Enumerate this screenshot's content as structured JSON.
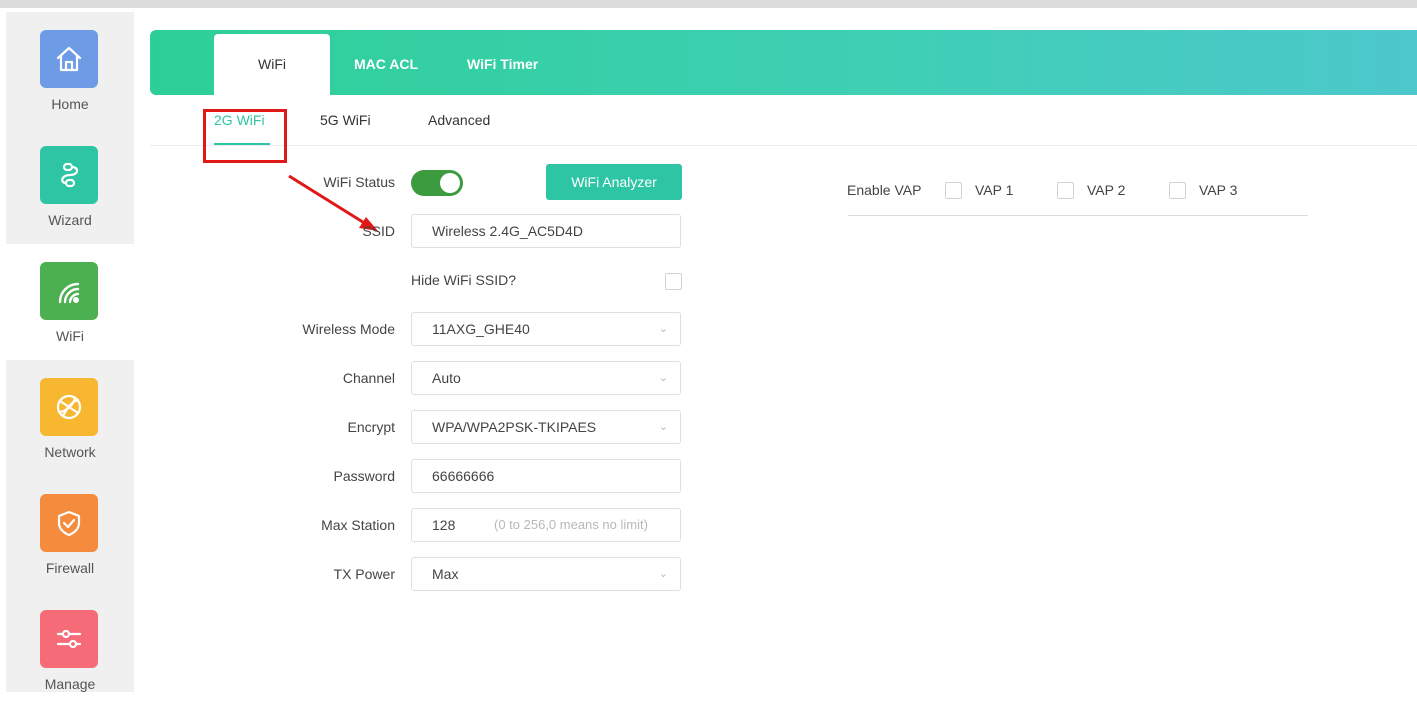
{
  "sidebar": {
    "items": [
      {
        "label": "Home",
        "icon": "home-icon",
        "color": "#6e9be6"
      },
      {
        "label": "Wizard",
        "icon": "link-icon",
        "color": "#2ec5a4"
      },
      {
        "label": "WiFi",
        "icon": "wifi-icon",
        "color": "#4caf50"
      },
      {
        "label": "Network",
        "icon": "globe-icon",
        "color": "#f7b731"
      },
      {
        "label": "Firewall",
        "icon": "shield-icon",
        "color": "#f58b3c"
      },
      {
        "label": "Manage",
        "icon": "sliders-icon",
        "color": "#f56b78"
      }
    ],
    "active": "WiFi"
  },
  "top_tabs": [
    "WiFi",
    "MAC ACL",
    "WiFi Timer"
  ],
  "sub_tabs": [
    "2G WiFi",
    "5G WiFi",
    "Advanced"
  ],
  "form": {
    "wifi_status_label": "WiFi Status",
    "wifi_status_on": true,
    "analyzer_button": "WiFi Analyzer",
    "ssid_label": "SSID",
    "ssid_value": "Wireless 2.4G_AC5D4D",
    "hide_ssid_label": "Hide WiFi SSID?",
    "wireless_mode_label": "Wireless Mode",
    "wireless_mode_value": "11AXG_GHE40",
    "channel_label": "Channel",
    "channel_value": "Auto",
    "encrypt_label": "Encrypt",
    "encrypt_value": "WPA/WPA2PSK-TKIPAES",
    "password_label": "Password",
    "password_value": "66666666",
    "max_station_label": "Max Station",
    "max_station_value": "128",
    "max_station_hint": "(0 to 256,0 means no limit)",
    "tx_power_label": "TX Power",
    "tx_power_value": "Max"
  },
  "vap": {
    "label": "Enable VAP",
    "options": [
      "VAP 1",
      "VAP 2",
      "VAP 3"
    ]
  },
  "colors": {
    "accent": "#2ec5a4",
    "toggle_on": "#3c9a3f",
    "annotation_red": "#e01818"
  }
}
